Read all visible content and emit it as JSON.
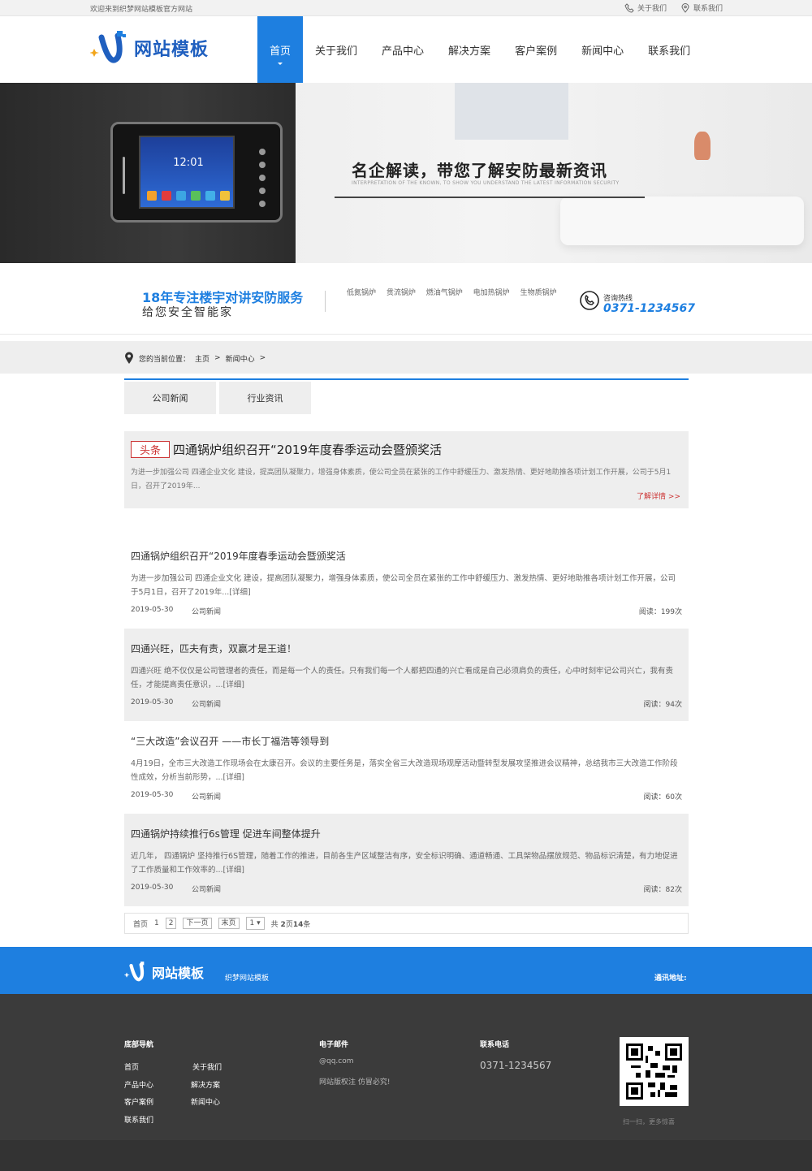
{
  "topbar": {
    "welcome": "欢迎来到织梦网站模板官方网站",
    "about": "关于我们",
    "contact": "联系我们"
  },
  "header": {
    "logo_text": "网站模板",
    "nav": [
      "首页",
      "关于我们",
      "产品中心",
      "解决方案",
      "客户案例",
      "新闻中心",
      "联系我们"
    ]
  },
  "banner": {
    "title": "名企解读，带您了解安防最新资讯",
    "subtitle": "INTERPRETATION OF THE KNOWN, TO SHOW YOU UNDERSTAND THE LATEST INFORMATION SECURITY",
    "clock": "12:01"
  },
  "strip": {
    "slogan1": "18年专注楼宇对讲安防服务",
    "slogan2": "给您安全智能家",
    "keywords": [
      "低氮锅炉",
      "贯流锅炉",
      "燃油气锅炉",
      "电加热锅炉",
      "生物质锅炉"
    ],
    "hotline_label": "咨询热线",
    "hotline": "0371-1234567"
  },
  "breadcrumb": {
    "label": "您的当前位置：",
    "home": "主页",
    "sep1": ">",
    "current": "新闻中心",
    "sep2": ">"
  },
  "tabs": [
    "公司新闻",
    "行业资讯"
  ],
  "headline": {
    "badge": "头条",
    "title": "四通锅炉组织召开“2019年度春季运动会暨颁奖活",
    "desc": "为进一步加强公司 四通企业文化 建设，提高团队凝聚力，增强身体素质，使公司全员在紧张的工作中舒缓压力、激发热情、更好地助推各项计划工作开展，公司于5月1日，召开了2019年...",
    "more": "了解详情 >>"
  },
  "news": [
    {
      "title": "四通锅炉组织召开“2019年度春季运动会暨颁奖活",
      "desc": "为进一步加强公司 四通企业文化 建设，提高团队凝聚力，增强身体素质，使公司全员在紧张的工作中舒缓压力、激发热情、更好地助推各项计划工作开展，公司于5月1日，召开了2019年...[详细]",
      "date": "2019-05-30",
      "category": "公司新闻",
      "reads": "阅读：199次"
    },
    {
      "title": "四通兴旺，匹夫有责，双赢才是王道！",
      "desc": "四通兴旺 绝不仅仅是公司管理者的责任，而是每一个人的责任。只有我们每一个人都把四通的兴亡看成是自己必须肩负的责任，心中时刻牢记公司兴亡，我有责任，才能提高责任意识，...[详细]",
      "date": "2019-05-30",
      "category": "公司新闻",
      "reads": "阅读：94次"
    },
    {
      "title": "“三大改造”会议召开 ——市长丁福浩等领导到",
      "desc": "4月19日，全市三大改造工作现场会在太康召开。会议的主要任务是，落实全省三大改造现场观摩活动暨转型发展攻坚推进会议精神，总结我市三大改造工作阶段性成效，分析当前形势，...[详细]",
      "date": "2019-05-30",
      "category": "公司新闻",
      "reads": "阅读：60次"
    },
    {
      "title": "四通锅炉持续推行6s管理 促进车间整体提升",
      "desc": "近几年， 四通锅炉 坚持推行6S管理，随着工作的推进，目前各生产区域整洁有序，安全标识明确、通道畅通、工具架物品摆放规范、物品标识清楚，有力地促进了工作质量和工作效率的...[详细]",
      "date": "2019-05-30",
      "category": "公司新闻",
      "reads": "阅读：82次"
    }
  ],
  "pager": {
    "first": "首页",
    "p1": "1",
    "p2": "2",
    "next": "下一页",
    "last": "末页",
    "select": "1",
    "total_prefix": "共",
    "total_pages": "2",
    "total_mid": "页",
    "total_items": "14",
    "total_suffix": "条"
  },
  "band": {
    "logo_text": "网站模板",
    "subtitle": "织梦网站模板",
    "address_label": "通讯地址:"
  },
  "footer": {
    "nav_title": "底部导航",
    "nav": [
      "首页",
      "关于我们",
      "产品中心",
      "解决方案",
      "客户案例",
      "新闻中心",
      "联系我们"
    ],
    "email_title": "电子邮件",
    "email": "@qq.com",
    "copyright": "网站版权注 仿冒必究!",
    "phone_title": "联系电话",
    "phone": "0371-1234567",
    "qr_caption": "扫一扫，更多惊喜"
  },
  "colors": {
    "primary": "#1e7fe0",
    "accent": "#cc3333",
    "footer": "#3b3b3b"
  }
}
